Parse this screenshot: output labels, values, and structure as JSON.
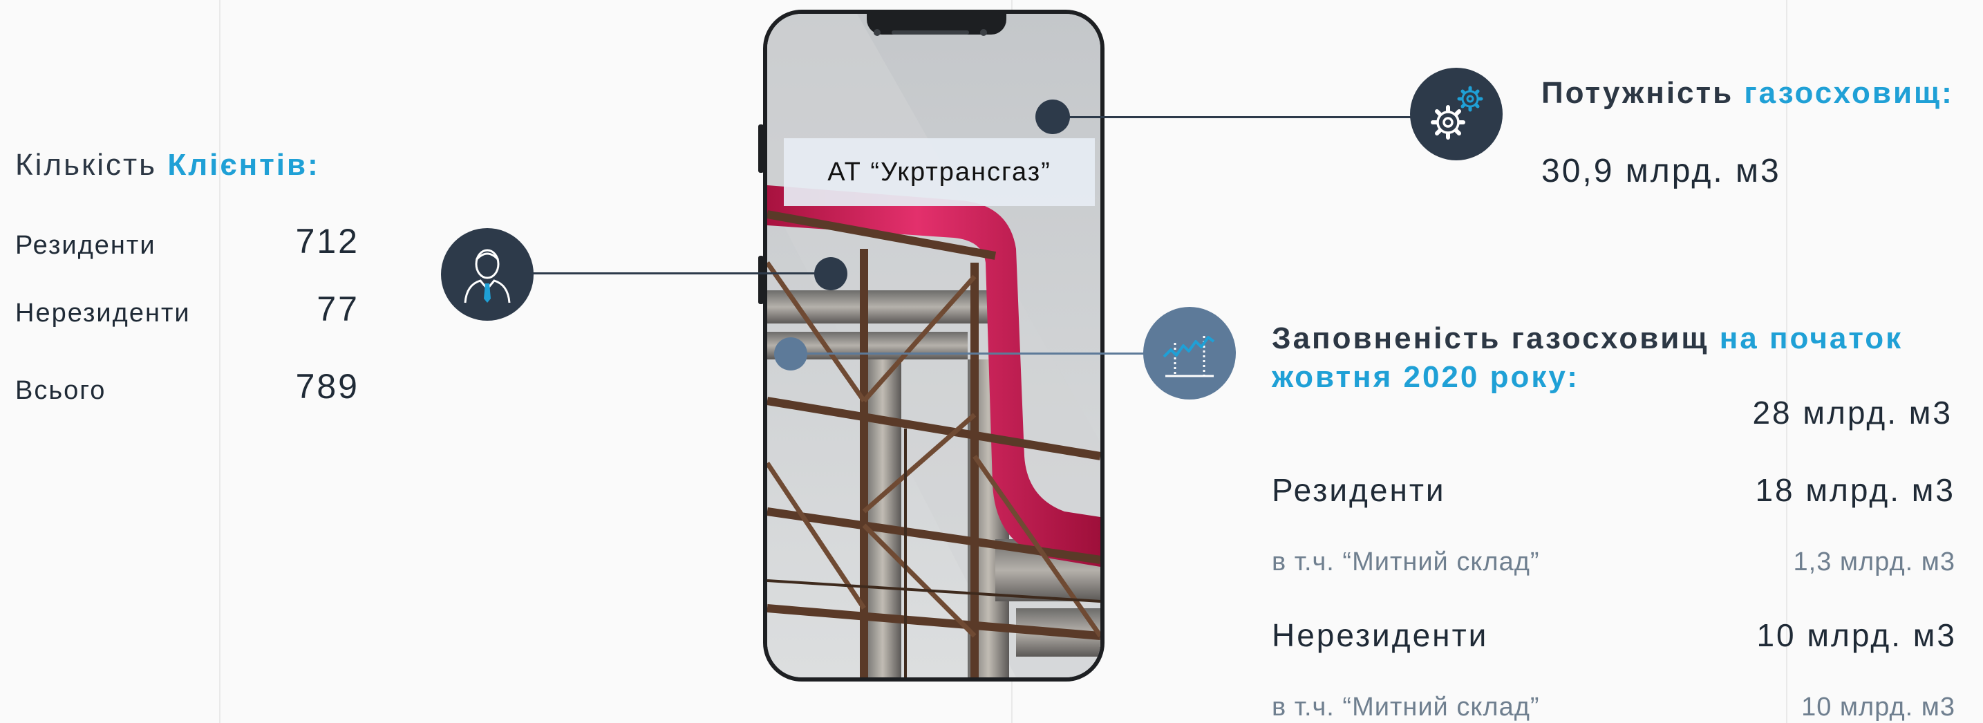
{
  "colors": {
    "accent": "#1fa0d6",
    "dark_navy": "#2d3a4a",
    "steel_blue": "#5d7a99",
    "pipe_red": "#d41e5a"
  },
  "phone": {
    "company_label": "АТ “Укртрансгаз”"
  },
  "clients": {
    "title_prefix": "Кількість ",
    "title_accent": "Клієнтів:",
    "icon": "user-icon",
    "rows": [
      {
        "label": "Резиденти",
        "value": "712"
      },
      {
        "label": "Нерезиденти",
        "value": "77"
      },
      {
        "label": "Всього",
        "value": "789"
      }
    ]
  },
  "capacity": {
    "title_prefix": "Потужність ",
    "title_accent": "газосховищ:",
    "value": "30,9 млрд. м3",
    "icon": "gears-icon"
  },
  "fill": {
    "title_prefix": "Заповненість газосховищ ",
    "title_accent_1": "на початок",
    "title_accent_2": "жовтня 2020 року:",
    "total": "28 млрд. м3",
    "icon": "chart-growth-icon",
    "residents_label": "Резиденти",
    "residents_value": "18 млрд. м3",
    "residents_sub_label": "в т.ч. “Митний склад”",
    "residents_sub_value": "1,3 млрд. м3",
    "nonresidents_label": "Нерезиденти",
    "nonresidents_value": "10 млрд. м3",
    "nonresidents_sub_label": "в т.ч. “Митний склад”",
    "nonresidents_sub_value": "10 млрд. м3"
  }
}
